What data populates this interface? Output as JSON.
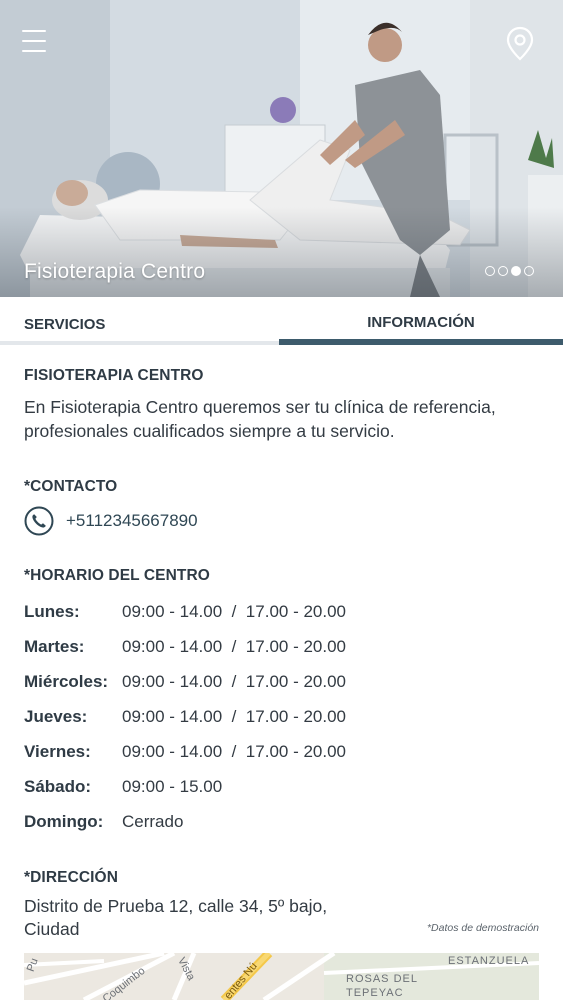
{
  "header": {
    "menu_icon": "hamburger-menu-icon",
    "location_icon": "map-pin-icon",
    "title": "Fisioterapia Centro",
    "carousel": {
      "count": 4,
      "active_index": 2
    }
  },
  "tabs": [
    {
      "label": "SERVICIOS",
      "active": false
    },
    {
      "label": "INFORMACIÓN",
      "active": true
    }
  ],
  "info": {
    "title": "FISIOTERAPIA CENTRO",
    "description": "En  Fisioterapia Centro queremos ser tu clínica de referencia, profesionales cualificados siempre a tu servicio.",
    "contact": {
      "heading": "*CONTACTO",
      "phone_icon": "phone-icon",
      "phone": "+5112345667890"
    },
    "schedule": {
      "heading": "*HORARIO DEL CENTRO",
      "rows": [
        {
          "day": "Lunes:",
          "hours": "09:00 - 14.00  /  17.00 - 20.00"
        },
        {
          "day": "Martes:",
          "hours": "09:00 - 14.00  /  17.00 - 20.00"
        },
        {
          "day": "Miércoles:",
          "hours": "09:00 - 14.00  /  17.00 - 20.00"
        },
        {
          "day": "Jueves:",
          "hours": "09:00 - 14.00  /  17.00 - 20.00"
        },
        {
          "day": "Viernes:",
          "hours": "09:00 - 14.00  /  17.00 - 20.00"
        },
        {
          "day": "Sábado:",
          "hours": "09:00 - 15.00"
        },
        {
          "day": "Domingo:",
          "hours": "Cerrado"
        }
      ]
    },
    "address": {
      "heading": "*DIRECCIÓN",
      "text": "Distrito de Prueba 12, calle 34, 5º bajo, Ciudad",
      "note": "*Datos de demostración"
    },
    "map": {
      "labels": [
        "ESTANZUELA",
        "ROSAS DEL",
        "TEPEYAC",
        "Coquimbo",
        "Vista",
        "entes Nú",
        "Pu"
      ]
    }
  },
  "colors": {
    "accent": "#3d5b6c",
    "text": "#333b43",
    "heading": "#2f3b45",
    "tab_inactive_bar": "#e3e7eb"
  }
}
